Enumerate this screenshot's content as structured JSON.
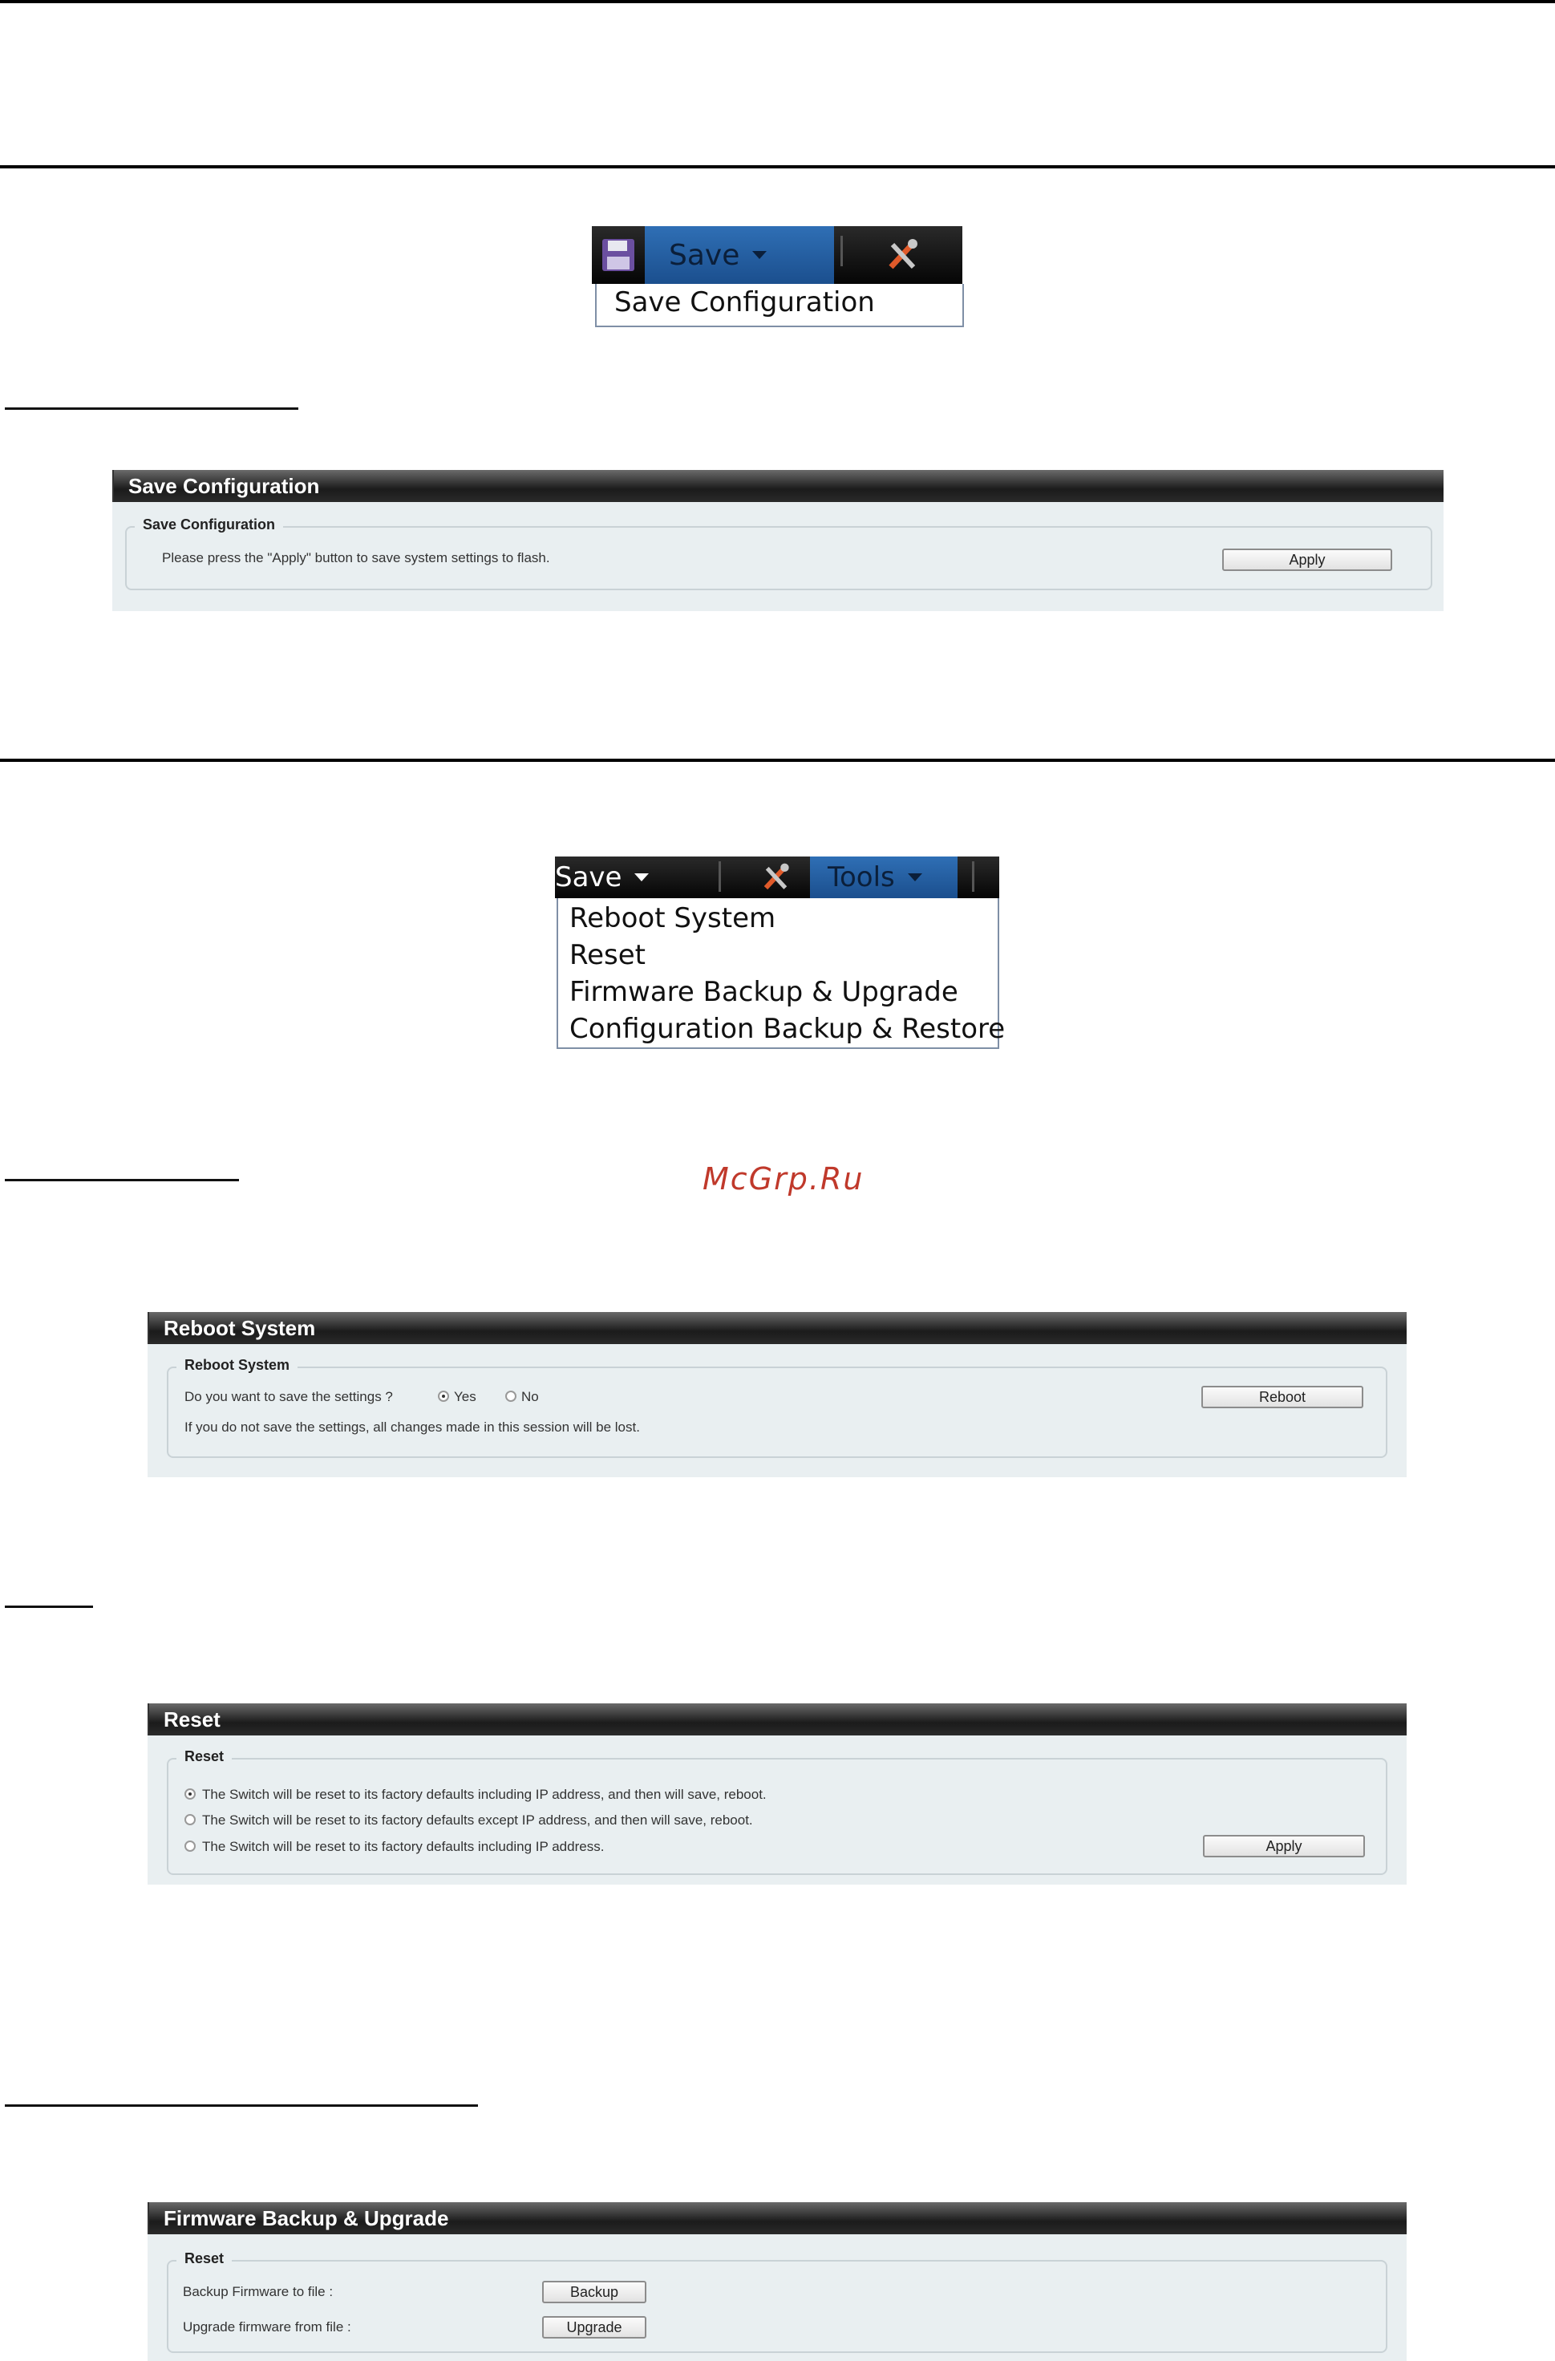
{
  "save_menu": {
    "save_label": "Save",
    "dropdown_items": [
      "Save Configuration"
    ]
  },
  "save_config_panel": {
    "title": "Save Configuration",
    "legend": "Save Configuration",
    "message": "Please press the \"Apply\" button to save system settings to flash.",
    "apply_label": "Apply"
  },
  "tools_menu": {
    "save_label": "Save",
    "tools_label": "Tools",
    "dropdown_items": [
      "Reboot System",
      "Reset",
      "Firmware Backup & Upgrade",
      "Configuration Backup & Restore"
    ]
  },
  "watermark": "McGrp.Ru",
  "reboot_panel": {
    "title": "Reboot System",
    "legend": "Reboot System",
    "question": "Do you want to save the settings ?",
    "yes_label": "Yes",
    "no_label": "No",
    "selected": "Yes",
    "warning": "If you do not save the settings, all changes made in this session will be lost.",
    "reboot_label": "Reboot"
  },
  "reset_panel": {
    "title": "Reset",
    "legend": "Reset",
    "options": [
      "The Switch will be reset to its factory defaults including IP address, and then will save, reboot.",
      "The Switch will be reset to its factory defaults except IP address, and then will save, reboot.",
      "The Switch will be reset to its factory defaults including IP address."
    ],
    "selected_index": 0,
    "apply_label": "Apply"
  },
  "firmware_panel": {
    "title": "Firmware Backup & Upgrade",
    "legend": "Reset",
    "backup_text": "Backup Firmware to file :",
    "backup_label": "Backup",
    "upgrade_text": "Upgrade firmware from file :",
    "upgrade_label": "Upgrade"
  }
}
